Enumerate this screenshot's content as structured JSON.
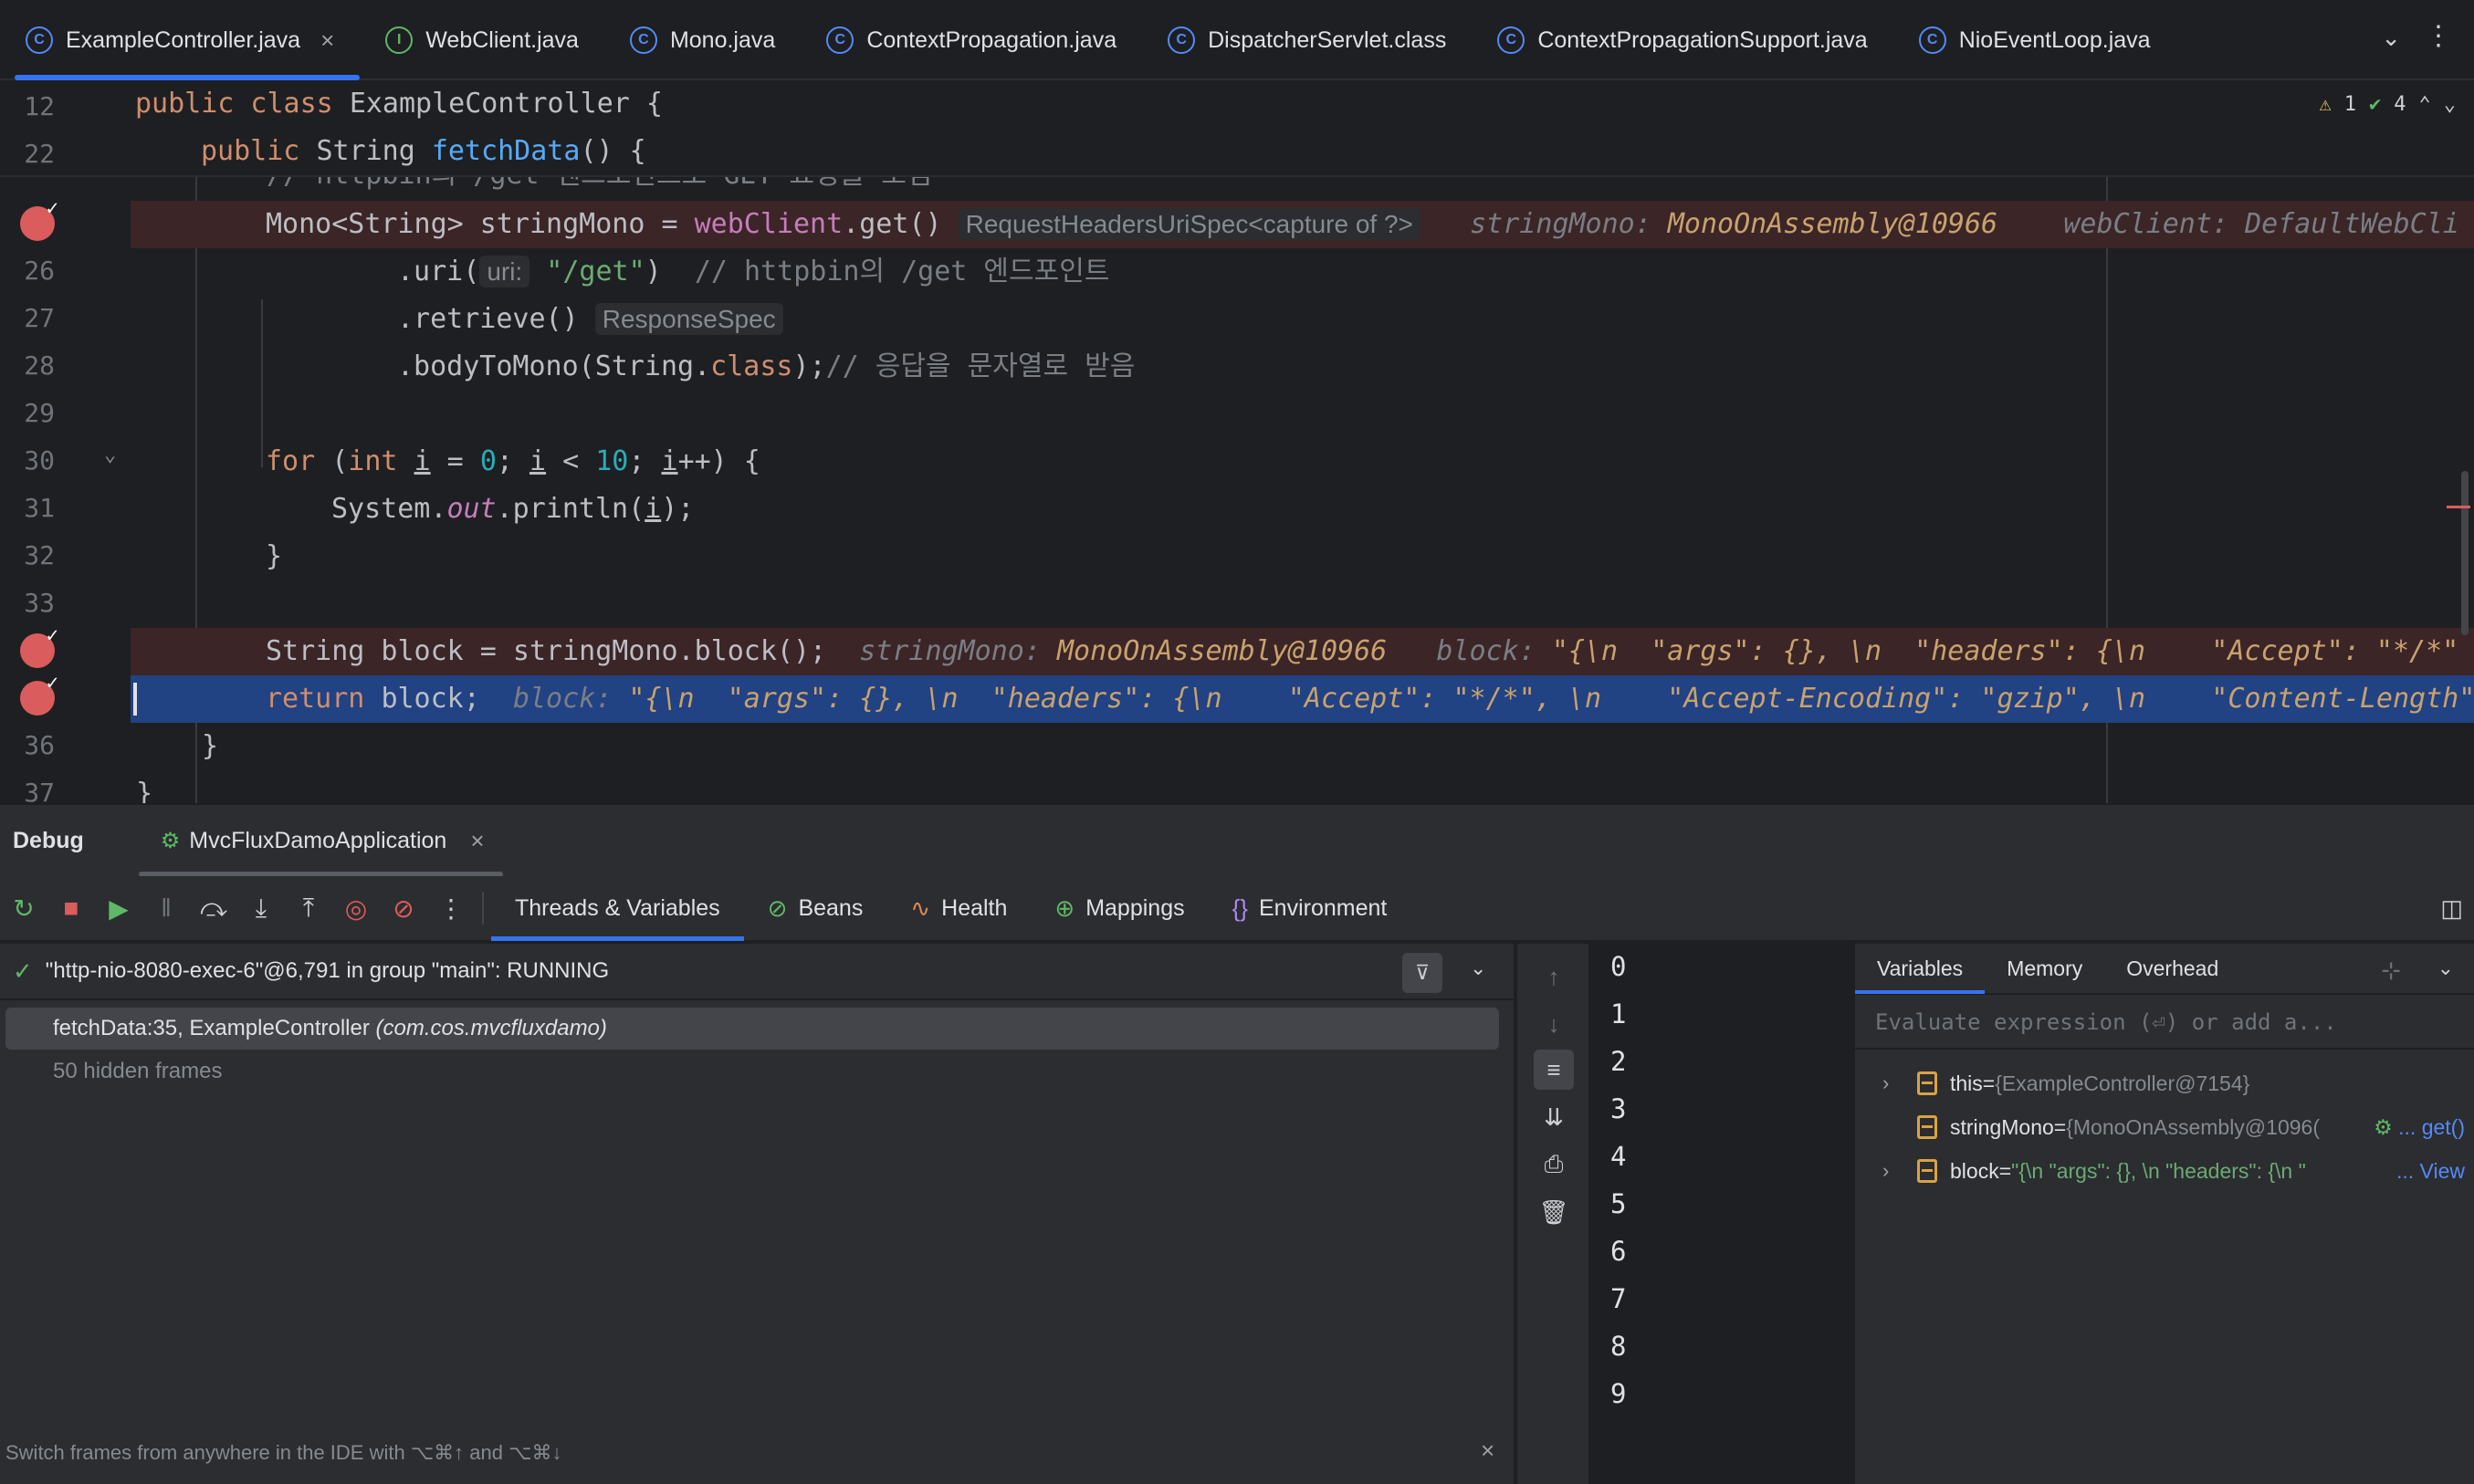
{
  "tabs": [
    {
      "label": "ExampleController.java",
      "icon": "class-icon",
      "active": true
    },
    {
      "label": "WebClient.java",
      "icon": "interface-icon"
    },
    {
      "label": "Mono.java",
      "icon": "class-icon"
    },
    {
      "label": "ContextPropagation.java",
      "icon": "class-icon"
    },
    {
      "label": "DispatcherServlet.class",
      "icon": "class-icon"
    },
    {
      "label": "ContextPropagationSupport.java",
      "icon": "class-icon"
    },
    {
      "label": "NioEventLoop.java",
      "icon": "class-icon"
    }
  ],
  "editor": {
    "inspection": {
      "warnings": "1",
      "ok": "4"
    },
    "sticky": [
      {
        "num": "12",
        "kw": "public class ",
        "name": "ExampleController",
        "rest": " {"
      },
      {
        "num": "22",
        "kw": "public ",
        "type": "String ",
        "fn": "fetchData",
        "rest": "() {"
      }
    ],
    "partial_comment": "// httpbin의 /get 엔드포인트로 GET 요청을 보냄",
    "lines": {
      "l25": {
        "code1": "Mono<String> stringMono = ",
        "field": "webClient",
        "code2": ".get()",
        "hint": "RequestHeadersUriSpec<capture of ?>",
        "i1k": "stringMono:",
        "i1v": "MonoOnAssembly@10966",
        "i2k": "webClient:",
        "i2v": "DefaultWebCli"
      },
      "l26": {
        "num": "26",
        "pre": ".uri(",
        "hint": "uri:",
        "str": "\"/get\"",
        "post": ")  ",
        "comment": "// httpbin의 /get 엔드포인트"
      },
      "l27": {
        "num": "27",
        "pre": ".retrieve()",
        "hint": "ResponseSpec"
      },
      "l28": {
        "num": "28",
        "pre": ".bodyToMono(String.",
        "kw": "class",
        "post": ");",
        "comment": "// 응답을 문자열로 받음"
      },
      "l29": {
        "num": "29"
      },
      "l30": {
        "num": "30",
        "kw": "for ",
        "p1": "(",
        "kw2": "int ",
        "v": "i",
        "p2": " = ",
        "n0": "0",
        "p3": "; ",
        "v2": "i",
        "p4": " < ",
        "n10": "10",
        "p5": "; ",
        "v3": "i",
        "p6": "++) {"
      },
      "l31": {
        "num": "31",
        "pre": "System.",
        "static": "out",
        "post": ".println(",
        "v": "i",
        "end": ");"
      },
      "l32": {
        "num": "32",
        "code": "}"
      },
      "l33": {
        "num": "33"
      },
      "l34": {
        "code": "String block = stringMono.block();",
        "i1k": "stringMono:",
        "i1v": "MonoOnAssembly@10966",
        "i2k": "block:",
        "i2v": "\"{\\n  \"args\": {}, \\n  \"headers\": {\\n    \"Accept\": \"*/*\""
      },
      "l35": {
        "kw": "return ",
        "code": "block;",
        "ik": "block:",
        "iv": "\"{\\n  \"args\": {}, \\n  \"headers\": {\\n    \"Accept\": \"*/*\", \\n    \"Accept-Encoding\": \"gzip\", \\n    \"Content-Length\""
      },
      "l36": {
        "num": "36",
        "code": "}"
      },
      "l37": {
        "num": "37",
        "code": "}"
      }
    }
  },
  "debug": {
    "title": "Debug",
    "session": "MvcFluxDamoApplication",
    "toolbar_tabs": [
      {
        "label": "Threads & Variables",
        "active": true
      },
      {
        "label": "Beans",
        "icon": "beans-icon"
      },
      {
        "label": "Health",
        "icon": "health-icon"
      },
      {
        "label": "Mappings",
        "icon": "mappings-icon"
      },
      {
        "label": "Environment",
        "icon": "environment-icon"
      }
    ],
    "thread": "\"http-nio-8080-exec-6\"@6,791 in group \"main\": RUNNING",
    "frame_method": "fetchData:35, ExampleController ",
    "frame_package": "(com.cos.mvcfluxdamo)",
    "hidden_frames": "50 hidden frames",
    "tip": "Switch frames from anywhere in the IDE with ⌥⌘↑ and ⌥⌘↓"
  },
  "console": {
    "lines": [
      "0",
      "1",
      "2",
      "3",
      "4",
      "5",
      "6",
      "7",
      "8",
      "9"
    ]
  },
  "variables": {
    "tabs": [
      "Variables",
      "Memory",
      "Overhead"
    ],
    "eval_placeholder": "Evaluate expression (⏎) or add a...",
    "rows": [
      {
        "name": "this",
        "eq": " = ",
        "value": "{ExampleController@7154}"
      },
      {
        "name": "stringMono",
        "eq": " = ",
        "value": "{MonoOnAssembly@1096(",
        "link": "... get()"
      },
      {
        "name": "block",
        "eq": " = ",
        "value": "\"{\\n  \"args\": {}, \\n  \"headers\": {\\n    \"",
        "link": "... View"
      }
    ]
  },
  "colors": {
    "accent": "#3574f0",
    "breakpoint": "#db5c5c",
    "current_line": "#214283"
  }
}
